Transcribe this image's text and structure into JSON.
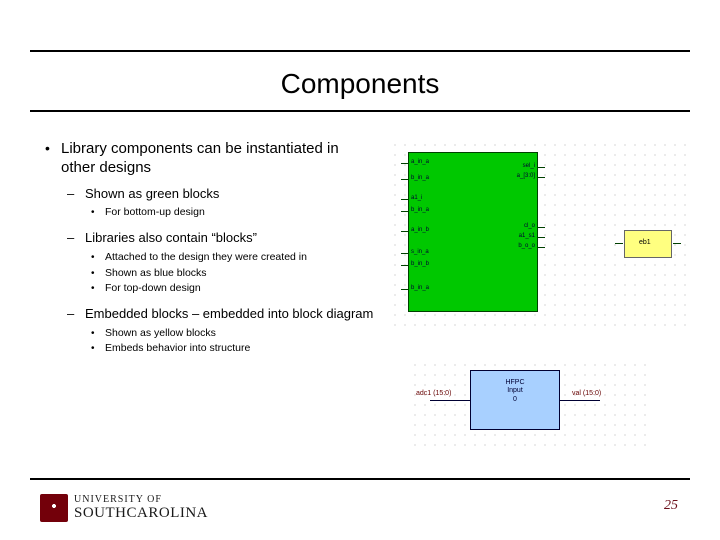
{
  "title": "Components",
  "bullets": {
    "main": "Library components can be instantiated in other designs",
    "sub": [
      {
        "text": "Shown as green blocks",
        "points": [
          "For bottom-up design"
        ]
      },
      {
        "text": "Libraries also contain “blocks”",
        "points": [
          "Attached to the design they were created in",
          "Shown as blue blocks",
          "For top-down design"
        ]
      },
      {
        "text": "Embedded blocks – embedded into block diagram",
        "points": [
          "Shown as yellow blocks",
          "Embeds behavior into structure"
        ]
      }
    ]
  },
  "diagrams": {
    "green": {
      "left_pins": [
        "a_in_a",
        "b_in_a",
        "a1_i",
        "b_in_a",
        "a_in_b",
        "s_in_a",
        "b_in_b",
        "b_in_a"
      ],
      "right_pins": [
        "sel_i",
        "a_[3:0]",
        "cl_o",
        "a1_s1",
        "b_o_o"
      ]
    },
    "yellow": {
      "label": "eb1"
    },
    "blue": {
      "title": "HFPC\nInput\n0",
      "left": "adc1 (15:0)",
      "right": "val (15:0)"
    }
  },
  "footer": {
    "university_small": "UNIVERSITY OF",
    "university_big": "SOUTH",
    "university_big2": "CAROLINA",
    "page": "25"
  }
}
